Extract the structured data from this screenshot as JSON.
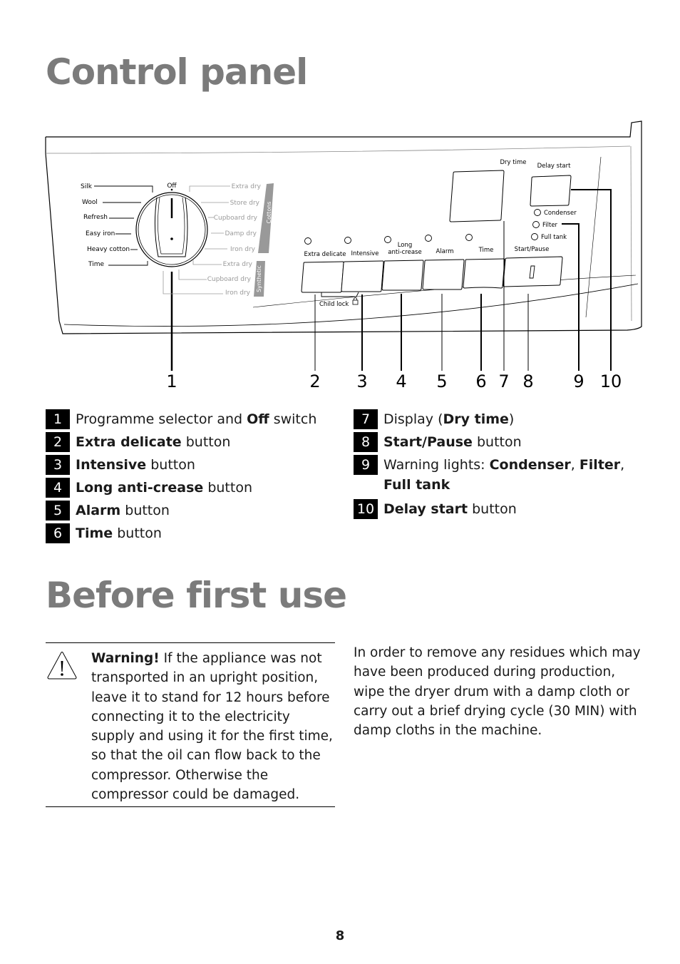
{
  "sections": {
    "control_panel_title": "Control panel",
    "before_first_use_title": "Before first use"
  },
  "diagram": {
    "dial": {
      "off_label": "Off",
      "left_programmes": [
        "Silk",
        "Wool",
        "Refresh",
        "Easy iron",
        "Heavy cotton",
        "Time"
      ],
      "cottons_label": "Cottons",
      "cottons_programmes": [
        "Extra dry",
        "Store dry",
        "Cupboard dry",
        "Damp dry",
        "Iron dry"
      ],
      "synthetic_label": "Synthetic",
      "synthetic_programmes": [
        "Extra dry",
        "Cupboard dry",
        "Iron dry"
      ]
    },
    "buttons": [
      "Extra delicate",
      "Intensive",
      "Long",
      "anti-crease",
      "Alarm",
      "Time",
      "Start/Pause"
    ],
    "child_lock_label": "Child lock",
    "display_label": "Dry time",
    "delay_start_label": "Delay start",
    "warning_lights": [
      "Condenser",
      "Filter",
      "Full tank"
    ],
    "callout_numbers": [
      "1",
      "2",
      "3",
      "4",
      "5",
      "6",
      "7",
      "8",
      "9",
      "10"
    ]
  },
  "legend": {
    "left": [
      {
        "num": "1",
        "pre": "Programme selector and ",
        "bold": "Off",
        "post": " switch"
      },
      {
        "num": "2",
        "pre": "",
        "bold": "Extra delicate",
        "post": " button"
      },
      {
        "num": "3",
        "pre": "",
        "bold": "Intensive",
        "post": " button"
      },
      {
        "num": "4",
        "pre": "",
        "bold": "Long anti-crease",
        "post": " button"
      },
      {
        "num": "5",
        "pre": "",
        "bold": "Alarm",
        "post": " button"
      },
      {
        "num": "6",
        "pre": "",
        "bold": "Time",
        "post": " button"
      }
    ],
    "right": [
      {
        "num": "7",
        "pre": "Display (",
        "bold": "Dry time",
        "post": ")"
      },
      {
        "num": "8",
        "pre": "",
        "bold": "Start/Pause",
        "post": " button"
      },
      {
        "num": "9",
        "pre": "Warning lights: ",
        "bold": "Condenser",
        "mid": ", ",
        "bold2": "Filter",
        "mid2": ", ",
        "bold3": "Full tank",
        "post": ""
      },
      {
        "num": "10",
        "pre": "",
        "bold": "Delay start",
        "post": " button"
      }
    ]
  },
  "warning": {
    "icon": "warning-triangle-icon",
    "bold": "Warning!",
    "text": " If the appliance was not transported in an upright position, leave it to stand for 12 hours before connecting it to the electricity supply and using it for the first time, so that the oil can flow back to the compressor. Otherwise the compressor could be damaged."
  },
  "intro_text": "In order to remove any residues which may have been produced during production, wipe the dryer drum with a damp cloth or carry out a brief drying cycle (30 MIN) with damp cloths in the machine.",
  "page_number": "8"
}
